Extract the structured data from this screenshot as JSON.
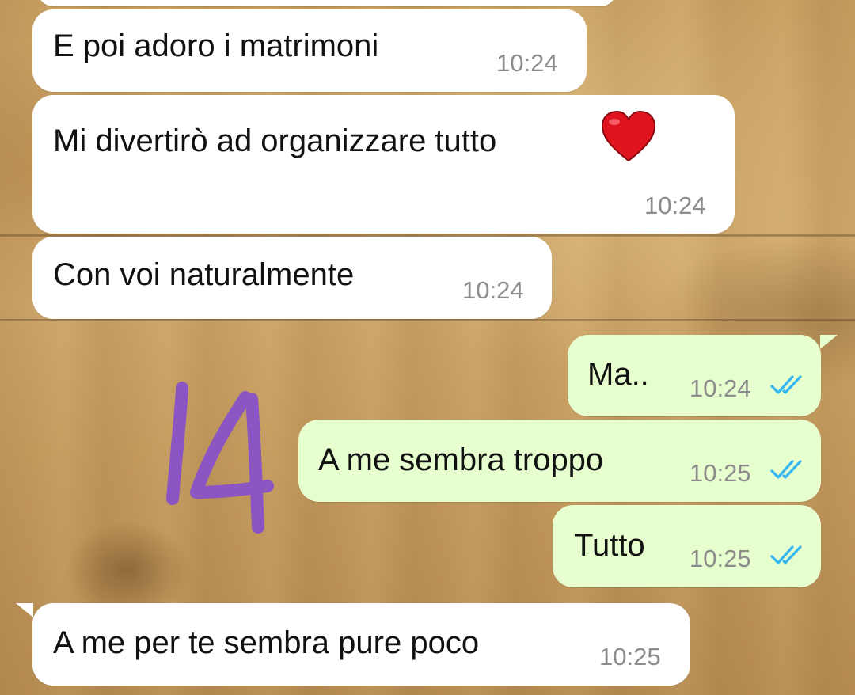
{
  "chat": {
    "messages": [
      {
        "id": "m1",
        "direction": "incoming",
        "text": "E poi adoro i matrimoni",
        "time": "10:24"
      },
      {
        "id": "m2",
        "direction": "incoming",
        "text": "Mi divertirò ad organizzare tutto",
        "emoji": "red-heart",
        "time": "10:24"
      },
      {
        "id": "m3",
        "direction": "incoming",
        "text": "Con voi naturalmente",
        "time": "10:24"
      },
      {
        "id": "m4",
        "direction": "outgoing",
        "text": "Ma..",
        "time": "10:24",
        "status": "read"
      },
      {
        "id": "m5",
        "direction": "outgoing",
        "text": "A me sembra troppo",
        "time": "10:25",
        "status": "read"
      },
      {
        "id": "m6",
        "direction": "outgoing",
        "text": "Tutto",
        "time": "10:25",
        "status": "read"
      },
      {
        "id": "m7",
        "direction": "incoming",
        "text": "A me per te sembra pure poco",
        "time": "10:25"
      }
    ]
  },
  "annotation": {
    "text": "14",
    "color": "#8b55c4"
  },
  "colors": {
    "incoming_bubble": "#ffffff",
    "outgoing_bubble": "#e7fecf",
    "read_ticks": "#34b7f1",
    "time_text": "#8c8c8c"
  },
  "icons": {
    "read_status": "double-check-icon",
    "emoji": "red-heart"
  }
}
